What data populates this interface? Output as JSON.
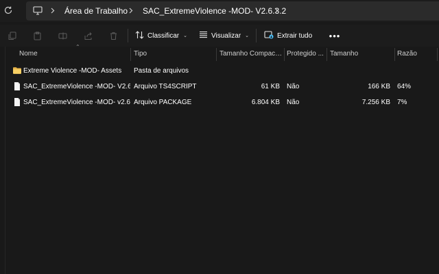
{
  "address_bar": {
    "breadcrumbs": [
      "Área de Trabalho",
      "SAC_ExtremeViolence -MOD- V2.6.3.2"
    ]
  },
  "command_bar": {
    "sort_label": "Classificar",
    "view_label": "Visualizar",
    "extract_label": "Extrair tudo"
  },
  "columns": {
    "name": "Nome",
    "type": "Tipo",
    "compressed_size": "Tamanho Compactado",
    "protected": "Protegido ...",
    "size": "Tamanho",
    "ratio": "Razão"
  },
  "files": [
    {
      "icon": "folder-icon",
      "name": "Extreme Violence -MOD- Assets",
      "type": "Pasta de arquivos",
      "compressed_size": "",
      "protected": "",
      "size": "",
      "ratio": ""
    },
    {
      "icon": "file-icon",
      "name": "SAC_ExtremeViolence -MOD- V2.6....",
      "type": "Arquivo TS4SCRIPT",
      "compressed_size": "61 KB",
      "protected": "Não",
      "size": "166 KB",
      "ratio": "64%"
    },
    {
      "icon": "file-icon",
      "name": "SAC_ExtremeViolence -MOD- v2.6....",
      "type": "Arquivo PACKAGE",
      "compressed_size": "6.804 KB",
      "protected": "Não",
      "size": "7.256 KB",
      "ratio": "7%"
    }
  ],
  "colors": {
    "background": "#191919",
    "toolbar": "#1c1c1c",
    "address_box": "#2b2b2b",
    "folder": "#f2c14e",
    "accent": "#4cc2ff"
  }
}
